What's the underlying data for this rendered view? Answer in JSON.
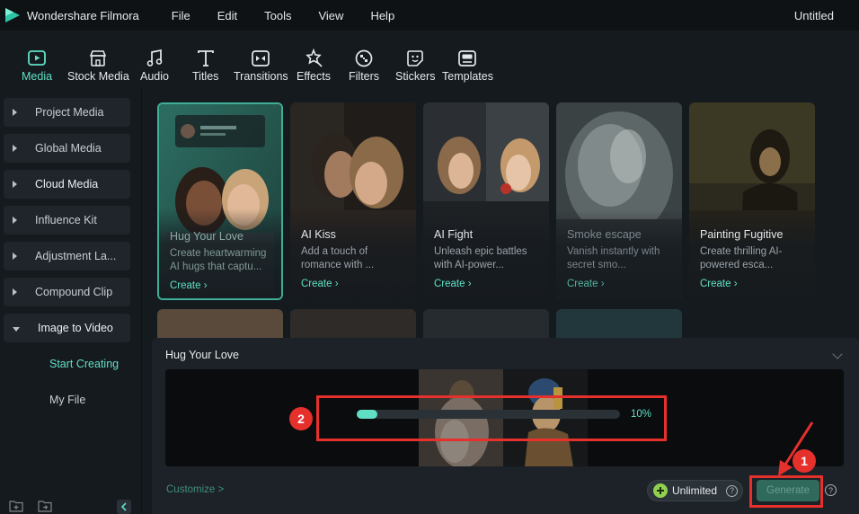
{
  "app": {
    "name": "Wondershare Filmora",
    "document_title": "Untitled"
  },
  "menu": [
    "File",
    "Edit",
    "Tools",
    "View",
    "Help"
  ],
  "toolbar": [
    {
      "label": "Media",
      "icon": "media-icon",
      "active": true
    },
    {
      "label": "Stock Media",
      "icon": "stock-media-icon"
    },
    {
      "label": "Audio",
      "icon": "music-note-icon"
    },
    {
      "label": "Titles",
      "icon": "title-t-icon"
    },
    {
      "label": "Transitions",
      "icon": "transitions-icon"
    },
    {
      "label": "Effects",
      "icon": "effects-icon"
    },
    {
      "label": "Filters",
      "icon": "filters-icon"
    },
    {
      "label": "Stickers",
      "icon": "stickers-icon"
    },
    {
      "label": "Templates",
      "icon": "templates-icon"
    }
  ],
  "sidebar": {
    "items": [
      {
        "label": "Project Media"
      },
      {
        "label": "Global Media"
      },
      {
        "label": "Cloud Media"
      },
      {
        "label": "Influence Kit"
      },
      {
        "label": "Adjustment La..."
      },
      {
        "label": "Compound Clip"
      },
      {
        "label": "Image to Video",
        "expanded": true
      }
    ],
    "subitems": [
      {
        "label": "Start Creating",
        "active": true
      },
      {
        "label": "My File"
      }
    ]
  },
  "cards": [
    {
      "title": "Hug Your Love",
      "desc": "Create heartwarming AI hugs that captu...",
      "cta": "Create",
      "selected": true
    },
    {
      "title": "AI Kiss",
      "desc": "Add a touch of romance with ...",
      "cta": "Create"
    },
    {
      "title": "AI Fight",
      "desc": "Unleash epic battles with AI-power...",
      "cta": "Create"
    },
    {
      "title": "Smoke escape",
      "desc": "Vanish instantly with secret smo...",
      "cta": "Create"
    },
    {
      "title": "Painting Fugitive",
      "desc": "Create thrilling AI-powered esca...",
      "cta": "Create"
    }
  ],
  "panel": {
    "title": "Hug Your Love",
    "progress": {
      "percent": 10,
      "label": "10%"
    },
    "customize_label": "Customize >",
    "unlimited_label": "Unlimited",
    "generate_label": "Generate",
    "help_glyph": "?"
  },
  "annotations": {
    "badge_1": "1",
    "badge_2": "2"
  },
  "colors": {
    "accent": "#5fe0c4",
    "highlight_red": "#e5302c",
    "background": "#151a1f"
  }
}
